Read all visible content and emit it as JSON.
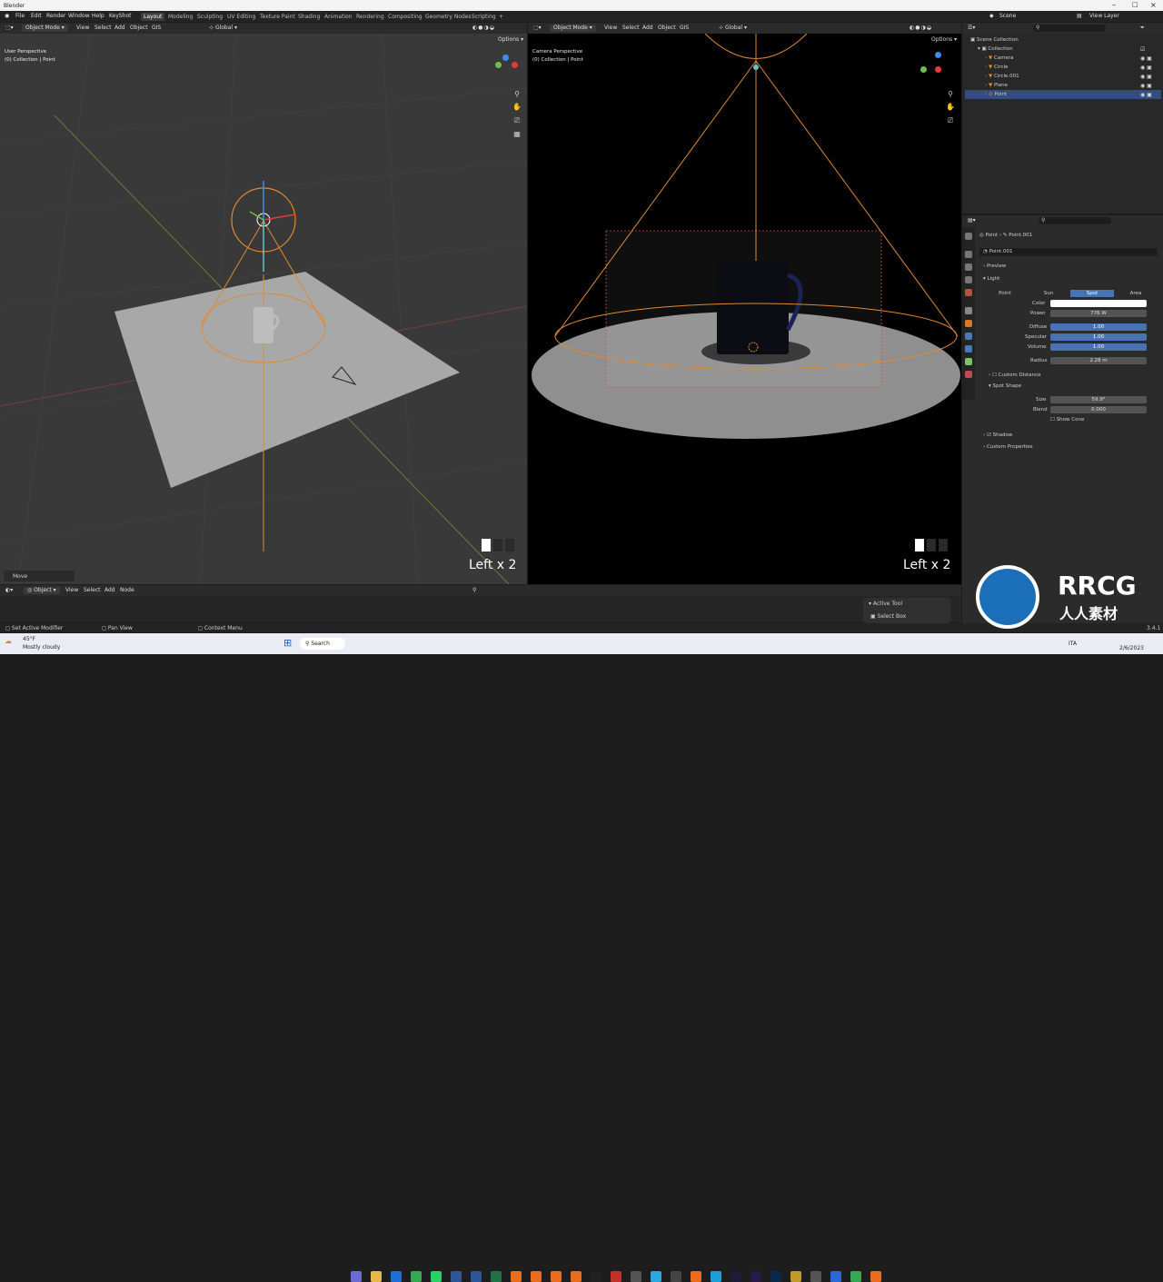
{
  "window": {
    "title": "Blender"
  },
  "menus": [
    "File",
    "Edit",
    "Render",
    "Window",
    "Help",
    "KeyShot"
  ],
  "workspaces": [
    "Layout",
    "Modeling",
    "Sculpting",
    "UV Editing",
    "Texture Paint",
    "Shading",
    "Animation",
    "Rendering",
    "Compositing",
    "Geometry Nodes",
    "Scripting",
    "+"
  ],
  "active_workspace": "Layout",
  "scene": {
    "name": "Scene",
    "view_layer": "View Layer"
  },
  "vp_header": {
    "mode": "Object Mode",
    "menu": [
      "View",
      "Select",
      "Add",
      "Object",
      "GIS"
    ],
    "orientation": "Global",
    "options": "Options"
  },
  "left_viewport": {
    "perspective": "User Perspective",
    "collection": "(0) Collection | Point",
    "key_hint": "Left x 2",
    "last_op": "Move"
  },
  "right_viewport": {
    "perspective": "Camera Perspective",
    "collection": "(0) Collection | Point",
    "key_hint": "Left x 2"
  },
  "outliner": {
    "root": "Scene Collection",
    "collection": "Collection",
    "items": [
      "Camera",
      "Circle",
      "Circle.001",
      "Plane",
      "Point"
    ],
    "selected": "Point"
  },
  "properties": {
    "breadcrumb_object": "Point",
    "breadcrumb_data": "Point.001",
    "datablock": "Point.001",
    "preview": "Preview",
    "light_panel": "Light",
    "light_types": [
      "Point",
      "Sun",
      "Spot",
      "Area"
    ],
    "active_type": "Spot",
    "color_label": "Color",
    "power_label": "Power",
    "power": "776 W",
    "diffuse_label": "Diffuse",
    "diffuse": "1.00",
    "specular_label": "Specular",
    "specular": "1.00",
    "volume_label": "Volume",
    "volume": "1.00",
    "radius_label": "Radius",
    "radius": "2.28 m",
    "custom_distance": "Custom Distance",
    "spot_shape": "Spot Shape",
    "size_label": "Size",
    "size": "59.9°",
    "blend_label": "Blend",
    "blend": "0.000",
    "show_cone": "Show Cone",
    "shadow": "Shadow",
    "custom_properties": "Custom Properties"
  },
  "timeline": {
    "mode": "Object",
    "menu": [
      "View",
      "Select",
      "Add",
      "Node"
    ]
  },
  "active_tool": {
    "title": "Active Tool",
    "tool": "Select Box"
  },
  "statusbar": {
    "items": [
      "Set Active Modifier",
      "Pan View",
      "Context Menu"
    ],
    "version": "3.4.1"
  },
  "taskbar": {
    "temp": "45°F",
    "weather": "Mostly cloudy",
    "search": "Search",
    "lang": "ITA",
    "date": "2/6/2023"
  },
  "watermark": {
    "logo_text": "RRCG",
    "sub_text": "人人素材"
  },
  "colors": {
    "accent": "#4772b3",
    "light_orange": "#e08a2e",
    "bg": "#1d1d1d"
  }
}
